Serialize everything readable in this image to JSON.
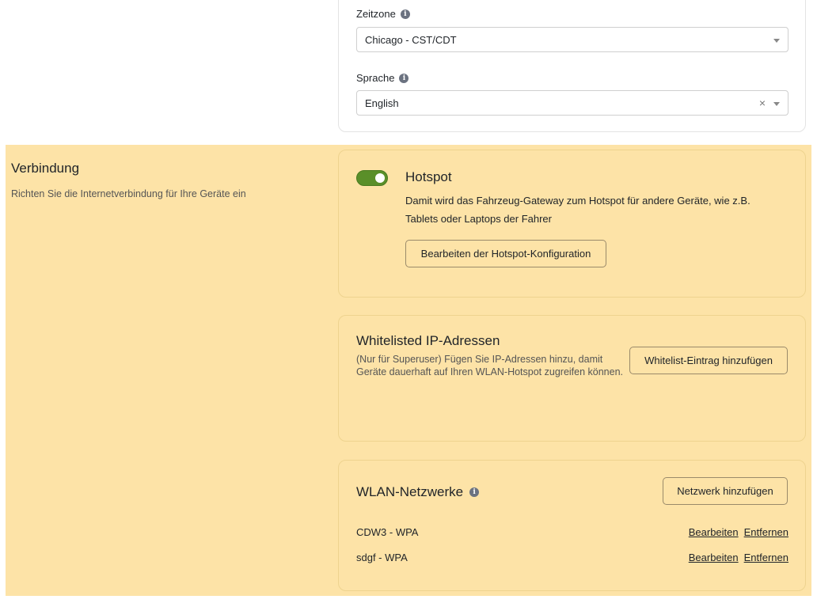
{
  "settings": {
    "timezone": {
      "label": "Zeitzone",
      "value": "Chicago - CST/CDT"
    },
    "language": {
      "label": "Sprache",
      "value": "English",
      "clear_symbol": "×"
    }
  },
  "connection": {
    "title": "Verbindung",
    "description": "Richten Sie die Internetverbindung für Ihre Geräte ein",
    "hotspot": {
      "enabled": true,
      "title": "Hotspot",
      "description": "Damit wird das Fahrzeug-Gateway zum Hotspot für andere Geräte, wie z.B. Tablets oder Laptops der Fahrer",
      "edit_button": "Bearbeiten der Hotspot-Konfiguration"
    },
    "whitelist": {
      "title": "Whitelisted IP-Adressen",
      "description": "(Nur für Superuser) Fügen Sie IP-Adressen hinzu, damit Geräte dauerhaft auf Ihren WLAN-Hotspot zugreifen können.",
      "add_button": "Whitelist-Eintrag hinzufügen"
    },
    "wlan": {
      "title": "WLAN-Netzwerke",
      "add_button": "Netzwerk hinzufügen",
      "networks": [
        {
          "name": "CDW3 - WPA",
          "edit": "Bearbeiten",
          "remove": "Entfernen"
        },
        {
          "name": "sdgf - WPA",
          "edit": "Bearbeiten",
          "remove": "Entfernen"
        }
      ]
    }
  },
  "colors": {
    "highlight": "#fde3a7",
    "toggle_on": "#5a8f29"
  }
}
